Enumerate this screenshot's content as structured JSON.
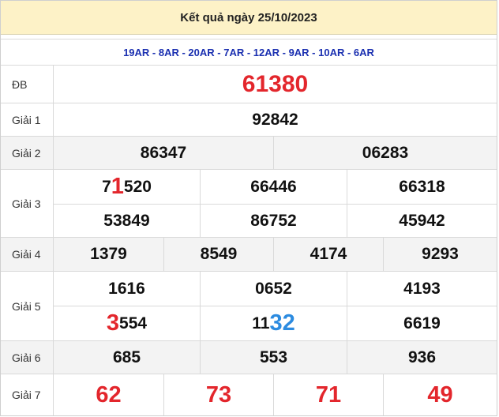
{
  "title": "Kết quả ngày 25/10/2023",
  "codes": "19AR - 8AR - 20AR - 7AR - 12AR - 9AR - 10AR - 6AR",
  "rows": {
    "db": {
      "label": "ĐB",
      "value": "61380"
    },
    "g1": {
      "label": "Giải 1",
      "value": "92842"
    },
    "g2": {
      "label": "Giải 2",
      "values": [
        "86347",
        "06283"
      ]
    },
    "g3": {
      "label": "Giải 3",
      "values": [
        {
          "pre": "7",
          "hl": "1",
          "post": "520"
        },
        "66446",
        "66318",
        "53849",
        "86752",
        "45942"
      ]
    },
    "g4": {
      "label": "Giải 4",
      "values": [
        "1379",
        "8549",
        "4174",
        "9293"
      ]
    },
    "g5": {
      "label": "Giải 5",
      "values": [
        "1616",
        "0652",
        "4193",
        {
          "pre": "",
          "hl": "3",
          "post": "554"
        },
        {
          "pre": "11",
          "hl": "32",
          "post": ""
        },
        "6619"
      ]
    },
    "g6": {
      "label": "Giải 6",
      "values": [
        "685",
        "553",
        "936"
      ]
    },
    "g7": {
      "label": "Giải 7",
      "values": [
        "62",
        "73",
        "71",
        "49"
      ]
    }
  },
  "colors": {
    "header_bg": "#fdf2c7",
    "codes_text": "#1a2fb0",
    "red": "#e3262c",
    "blue": "#2c8be0",
    "stripe": "#f3f3f3"
  }
}
